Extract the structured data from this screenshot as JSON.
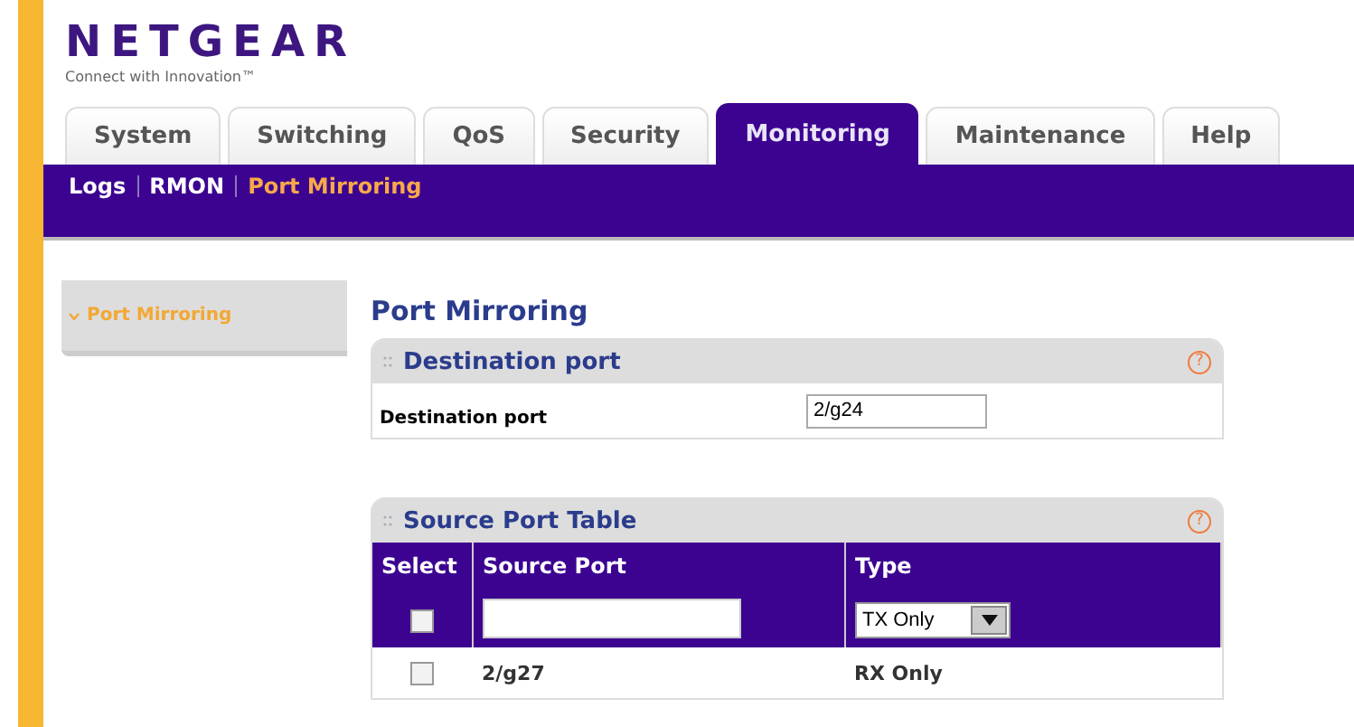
{
  "logo": {
    "name": "NETGEAR",
    "tagline": "Connect with Innovation™"
  },
  "tabs": [
    {
      "label": "System",
      "selected": false
    },
    {
      "label": "Switching",
      "selected": false
    },
    {
      "label": "QoS",
      "selected": false
    },
    {
      "label": "Security",
      "selected": false
    },
    {
      "label": "Monitoring",
      "selected": true
    },
    {
      "label": "Maintenance",
      "selected": false
    },
    {
      "label": "Help",
      "selected": false
    }
  ],
  "subnav": [
    {
      "label": "Logs",
      "selected": false
    },
    {
      "label": "RMON",
      "selected": false
    },
    {
      "label": "Port Mirroring",
      "selected": true
    }
  ],
  "sidebar": {
    "items": [
      {
        "label": "Port Mirroring"
      }
    ]
  },
  "page_title": "Port Mirroring",
  "destination_panel": {
    "title": "Destination port",
    "help": "?",
    "label": "Destination port",
    "value": "2/g24"
  },
  "source_panel": {
    "title": "Source Port Table",
    "help": "?",
    "columns": [
      "Select",
      "Source Port",
      "Type"
    ],
    "input_row": {
      "checked": false,
      "type": "TX Only"
    },
    "rows": [
      {
        "checked": false,
        "source_port": "2/g27",
        "type": "RX Only"
      }
    ]
  }
}
